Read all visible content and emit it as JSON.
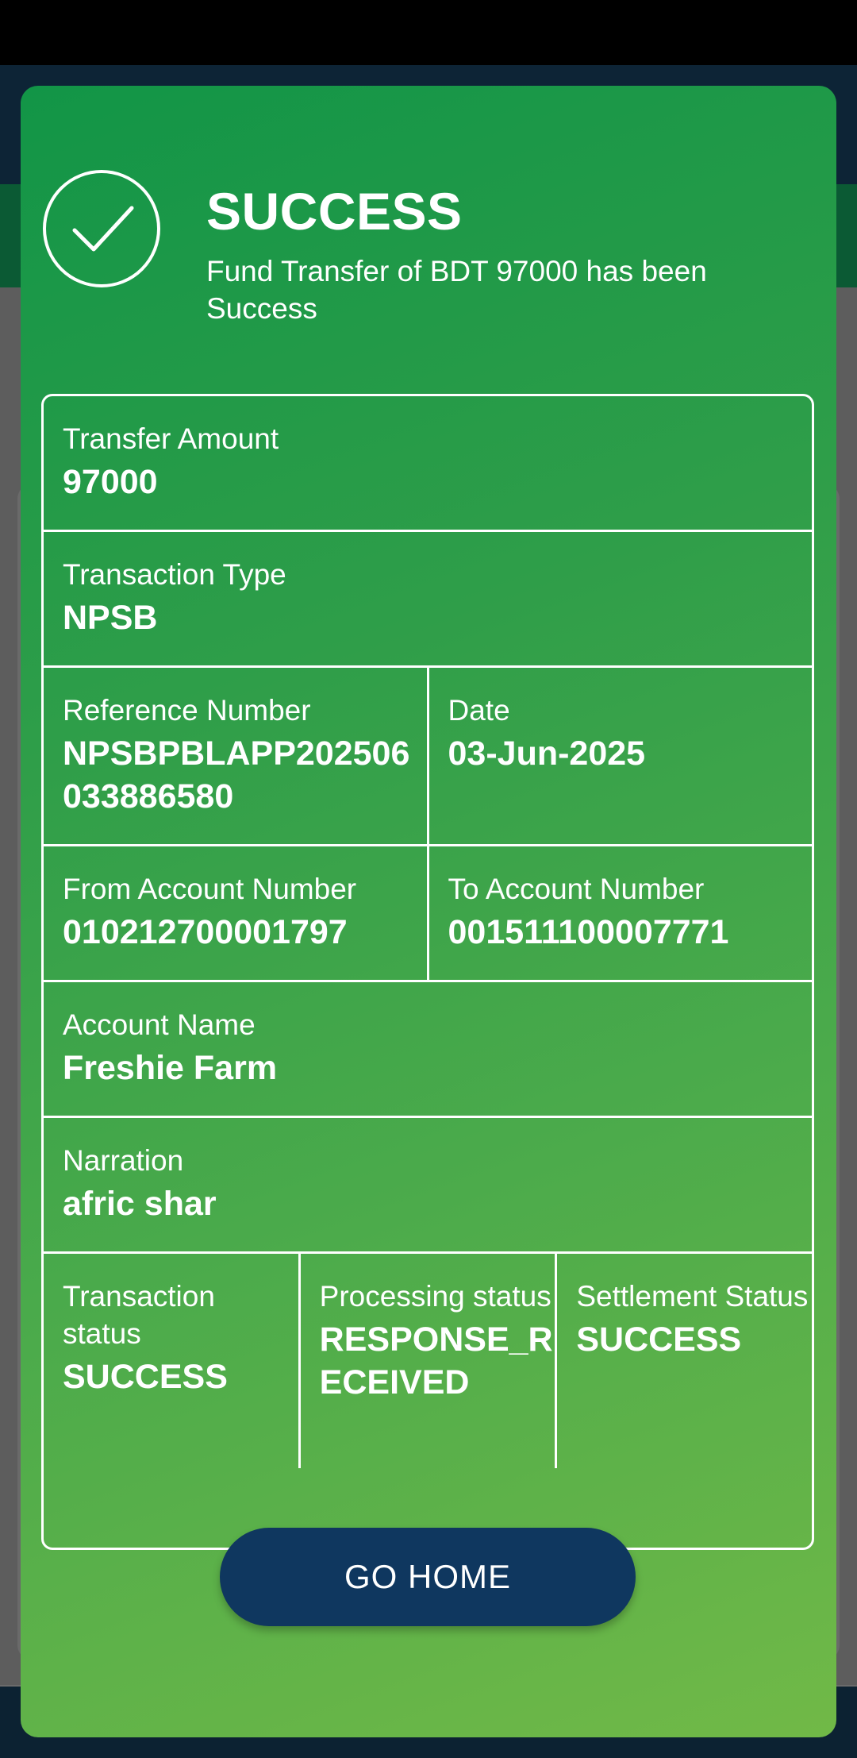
{
  "dialog": {
    "title": "SUCCESS",
    "message": "Fund Transfer of BDT 97000 has been Success"
  },
  "details": {
    "transfer_amount": {
      "label": "Transfer Amount",
      "value": "97000"
    },
    "transaction_type": {
      "label": "Transaction Type",
      "value": "NPSB"
    },
    "reference_number": {
      "label": "Reference Number",
      "value": "NPSBPBLAPP202506033886580"
    },
    "date": {
      "label": "Date",
      "value": "03-Jun-2025"
    },
    "from_account": {
      "label": "From Account Number",
      "value": "010212700001797"
    },
    "to_account": {
      "label": "To Account Number",
      "value": "001511100007771"
    },
    "account_name": {
      "label": "Account Name",
      "value": "Freshie Farm"
    },
    "narration": {
      "label": "Narration",
      "value": "afric shar"
    },
    "transaction_status": {
      "label": "Transaction status",
      "value": "SUCCESS"
    },
    "processing_status": {
      "label": "Processing status",
      "value": "RESPONSE_RECEIVED"
    },
    "settlement_status": {
      "label": "Settlement Status",
      "value": "SUCCESS"
    }
  },
  "actions": {
    "go_home_label": "GO HOME"
  },
  "colors": {
    "gradient_top": "#129547",
    "gradient_bottom": "#71b947",
    "button_bg": "#0f375f",
    "text": "#ffffff"
  },
  "icons": {
    "status": "checkmark-circle-icon"
  }
}
